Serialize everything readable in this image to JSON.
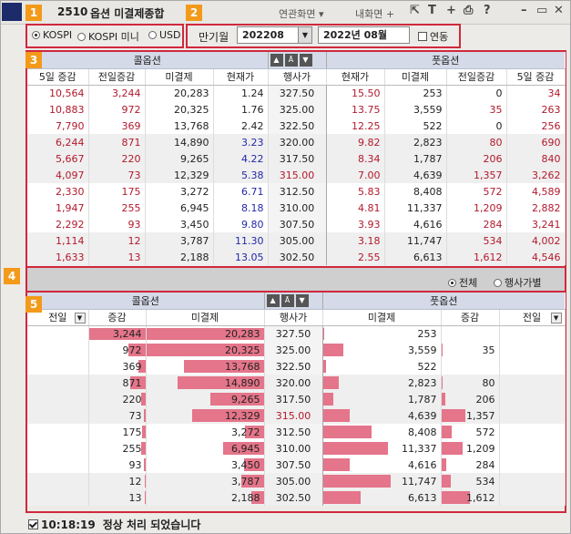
{
  "app": {
    "screen_no": "2510",
    "title": "옵션 미결제종합"
  },
  "titlebar": {
    "linked_screen": "연관화면",
    "my_screen": "내화면",
    "icons": [
      "share-icon",
      "text-icon",
      "plus-icon",
      "print-icon",
      "help-icon",
      "minimize-icon",
      "maximize-icon",
      "close-icon"
    ]
  },
  "badges": [
    "1",
    "2",
    "3",
    "4",
    "5"
  ],
  "market": {
    "options": [
      "KOSPI",
      "KOSPI 미니",
      "USD"
    ],
    "selected": "KOSPI"
  },
  "expiry": {
    "label": "만기월",
    "value": "202208",
    "display": "2022년 08월",
    "linked_label": "연동",
    "linked_checked": true
  },
  "top_table": {
    "call_header": "콜옵션",
    "put_header": "풋옵션",
    "columns": [
      "5일 증감",
      "전일증감",
      "미결제",
      "현재가",
      "행사가",
      "현재가",
      "미결제",
      "전일증감",
      "5일 증감"
    ],
    "rows": [
      [
        "10,564",
        "3,244",
        "20,283",
        "1.24",
        "327.50",
        "15.50",
        "253",
        "0",
        "34"
      ],
      [
        "10,883",
        "972",
        "20,325",
        "1.76",
        "325.00",
        "13.75",
        "3,559",
        "35",
        "263"
      ],
      [
        "7,790",
        "369",
        "13,768",
        "2.42",
        "322.50",
        "12.25",
        "522",
        "0",
        "256"
      ],
      [
        "6,244",
        "871",
        "14,890",
        "3.23",
        "320.00",
        "9.82",
        "2,823",
        "80",
        "690"
      ],
      [
        "5,667",
        "220",
        "9,265",
        "4.22",
        "317.50",
        "8.34",
        "1,787",
        "206",
        "840"
      ],
      [
        "4,097",
        "73",
        "12,329",
        "5.38",
        "315.00",
        "7.00",
        "4,639",
        "1,357",
        "3,262"
      ],
      [
        "2,330",
        "175",
        "3,272",
        "6.71",
        "312.50",
        "5.83",
        "8,408",
        "572",
        "4,589"
      ],
      [
        "1,947",
        "255",
        "6,945",
        "8.18",
        "310.00",
        "4.81",
        "11,337",
        "1,209",
        "2,882"
      ],
      [
        "2,292",
        "93",
        "3,450",
        "9.80",
        "307.50",
        "3.93",
        "4,616",
        "284",
        "3,241"
      ],
      [
        "1,114",
        "12",
        "3,787",
        "11.30",
        "305.00",
        "3.18",
        "11,747",
        "534",
        "4,002"
      ],
      [
        "1,633",
        "13",
        "2,188",
        "13.05",
        "302.50",
        "2.55",
        "6,613",
        "1,612",
        "4,546"
      ]
    ]
  },
  "filter": {
    "options": [
      "전체",
      "행사가별"
    ],
    "selected": "전체"
  },
  "bottom_table": {
    "call_header": "콜옵션",
    "put_header": "풋옵션",
    "period_left": "전일",
    "period_right": "전일",
    "columns": [
      "증감",
      "미결제",
      "행사가",
      "미결제",
      "증감"
    ],
    "rows": [
      {
        "call_chg": "3,244",
        "call_chg_v": 3244,
        "call_oi": "20,283",
        "call_oi_v": 20283,
        "strike": "327.50",
        "put_oi": "253",
        "put_oi_v": 253,
        "put_chg": "",
        "put_chg_v": 0
      },
      {
        "call_chg": "972",
        "call_chg_v": 972,
        "call_oi": "20,325",
        "call_oi_v": 20325,
        "strike": "325.00",
        "put_oi": "3,559",
        "put_oi_v": 3559,
        "put_chg": "35",
        "put_chg_v": 35
      },
      {
        "call_chg": "369",
        "call_chg_v": 369,
        "call_oi": "13,768",
        "call_oi_v": 13768,
        "strike": "322.50",
        "put_oi": "522",
        "put_oi_v": 522,
        "put_chg": "",
        "put_chg_v": 0
      },
      {
        "call_chg": "871",
        "call_chg_v": 871,
        "call_oi": "14,890",
        "call_oi_v": 14890,
        "strike": "320.00",
        "put_oi": "2,823",
        "put_oi_v": 2823,
        "put_chg": "80",
        "put_chg_v": 80
      },
      {
        "call_chg": "220",
        "call_chg_v": 220,
        "call_oi": "9,265",
        "call_oi_v": 9265,
        "strike": "317.50",
        "put_oi": "1,787",
        "put_oi_v": 1787,
        "put_chg": "206",
        "put_chg_v": 206
      },
      {
        "call_chg": "73",
        "call_chg_v": 73,
        "call_oi": "12,329",
        "call_oi_v": 12329,
        "strike": "315.00",
        "put_oi": "4,639",
        "put_oi_v": 4639,
        "put_chg": "1,357",
        "put_chg_v": 1357
      },
      {
        "call_chg": "175",
        "call_chg_v": 175,
        "call_oi": "3,272",
        "call_oi_v": 3272,
        "strike": "312.50",
        "put_oi": "8,408",
        "put_oi_v": 8408,
        "put_chg": "572",
        "put_chg_v": 572
      },
      {
        "call_chg": "255",
        "call_chg_v": 255,
        "call_oi": "6,945",
        "call_oi_v": 6945,
        "strike": "310.00",
        "put_oi": "11,337",
        "put_oi_v": 11337,
        "put_chg": "1,209",
        "put_chg_v": 1209
      },
      {
        "call_chg": "93",
        "call_chg_v": 93,
        "call_oi": "3,450",
        "call_oi_v": 3450,
        "strike": "307.50",
        "put_oi": "4,616",
        "put_oi_v": 4616,
        "put_chg": "284",
        "put_chg_v": 284
      },
      {
        "call_chg": "12",
        "call_chg_v": 12,
        "call_oi": "3,787",
        "call_oi_v": 3787,
        "strike": "305.00",
        "put_oi": "11,747",
        "put_oi_v": 11747,
        "put_chg": "534",
        "put_chg_v": 534
      },
      {
        "call_chg": "13",
        "call_chg_v": 13,
        "call_oi": "2,188",
        "call_oi_v": 2188,
        "strike": "302.50",
        "put_oi": "6,613",
        "put_oi_v": 6613,
        "put_chg": "1,612",
        "put_chg_v": 1612
      }
    ]
  },
  "status": {
    "time": "10:18:19",
    "message": "정상 처리 되었습니다"
  },
  "colors": {
    "bar": "#e4758a",
    "header_bg": "#d5dae8",
    "highlight": "#d0283d",
    "badge": "#f39a1a",
    "positive": "#b2192c",
    "price": "#2328a8"
  }
}
